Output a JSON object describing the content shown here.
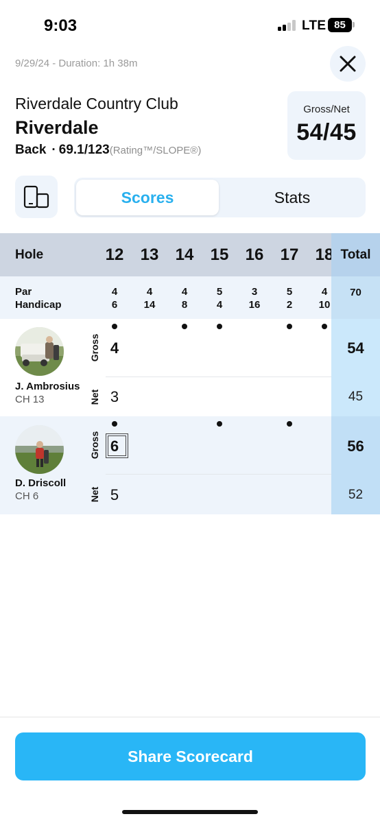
{
  "status_bar": {
    "time": "9:03",
    "network": "LTE",
    "battery": "85"
  },
  "header": {
    "meta": "9/29/24 - Duration: 1h 38m",
    "course_name": "Riverdale Country Club",
    "course_sub": "Riverdale",
    "tee": "Back",
    "separator": "·",
    "rating": "69.1/123",
    "rating_label": "(Rating™/SLOPE®)",
    "gross_net_label": "Gross/Net",
    "gross_net_value": "54/45"
  },
  "icons": {
    "close": "close-icon",
    "device": "device-layout-icon"
  },
  "tabs": {
    "scores": "Scores",
    "stats": "Stats",
    "active": "scores"
  },
  "scorecard": {
    "hole_label": "Hole",
    "total_label": "Total",
    "holes": [
      "12",
      "13",
      "14",
      "15",
      "16",
      "17",
      "18"
    ],
    "par_label": "Par",
    "handicap_label": "Handicap",
    "par": [
      "4",
      "4",
      "4",
      "5",
      "3",
      "5",
      "4"
    ],
    "handicap": [
      "6",
      "14",
      "8",
      "4",
      "16",
      "2",
      "10"
    ],
    "par_total": "70",
    "gross_label": "Gross",
    "net_label": "Net",
    "players": [
      {
        "name": "J. Ambrosius",
        "course_handicap": "CH 13",
        "gross": [
          "4",
          "",
          "",
          "",
          "",
          "",
          ""
        ],
        "net": [
          "3",
          "",
          "",
          "",
          "",
          "",
          ""
        ],
        "stroke_dots": [
          true,
          false,
          true,
          true,
          false,
          true,
          true
        ],
        "gross_total": "54",
        "net_total": "45"
      },
      {
        "name": "D. Driscoll",
        "course_handicap": "CH 6",
        "gross": [
          "6",
          "",
          "",
          "",
          "",
          "",
          ""
        ],
        "net": [
          "5",
          "",
          "",
          "",
          "",
          "",
          ""
        ],
        "stroke_dots": [
          true,
          false,
          false,
          true,
          false,
          true,
          false
        ],
        "gross_total": "56",
        "net_total": "52"
      }
    ]
  },
  "footer": {
    "share_label": "Share Scorecard"
  },
  "colors": {
    "accent": "#29b6f6",
    "active_tab_text": "#29b0ee",
    "header_row": "#cdd5e1",
    "total_column": "#b6d2ec",
    "light_panel": "#eef4fb"
  }
}
